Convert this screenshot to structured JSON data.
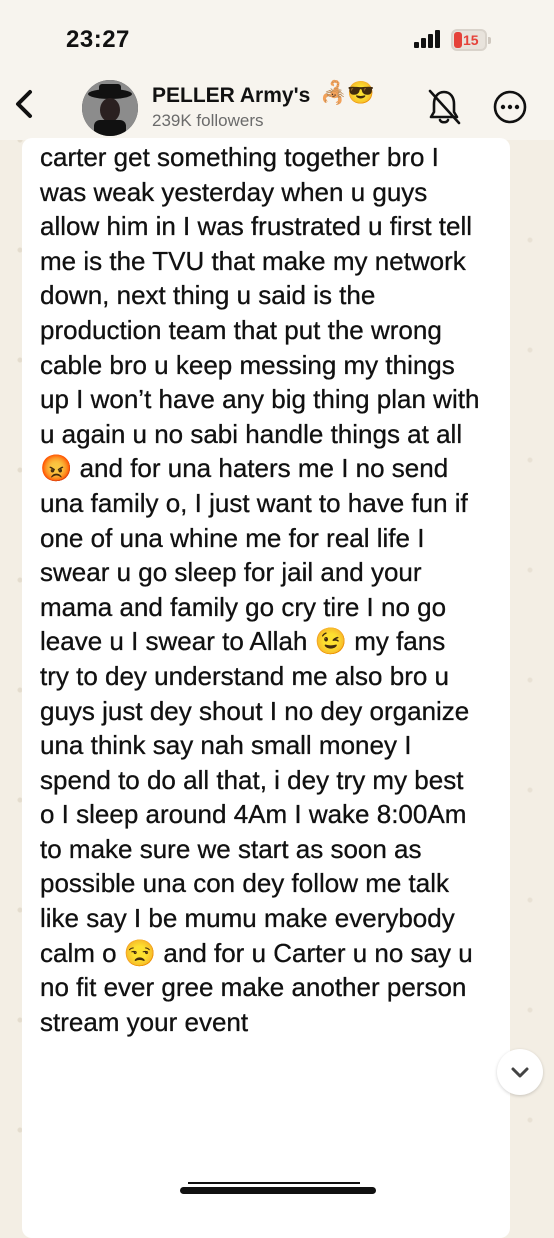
{
  "status_bar": {
    "time": "23:27",
    "battery_level": "15",
    "battery_color": "#e5423a"
  },
  "header": {
    "channel_name": "PELLER Army's",
    "name_emojis": "🦂😎",
    "followers": "239K followers",
    "icons": [
      "back-chevron-icon",
      "avatar",
      "mute-bell-icon",
      "more-options-icon"
    ]
  },
  "message": {
    "text": "carter get something together bro I was weak yesterday when u guys allow him in I was frustrated u first tell me is the TVU that make my network down, next thing u said is the production team that put the wrong cable bro u keep messing my things up I won’t have any big thing plan with u again u no sabi handle things at all😡 and for una haters me I no send una family o, I just want to have fun if one of una whine me for real life I swear u go sleep for jail and your mama and family go cry tire I no go leave u I swear to Allah 😉 my fans try to dey understand me also bro u guys just dey shout I no dey organize una think say nah small money I spend to do all that, i dey try my best o I sleep around 4Am I wake 8:00Am to make sure we start as soon as possible una con dey follow me talk like say I be mumu make everybody calm o 😒 and for u Carter u no say u no fit ever gree make another person stream your event"
  },
  "colors": {
    "background": "#f3eee4",
    "bubble": "#ffffff",
    "text": "#111111",
    "muted_text": "#6b6b6b"
  }
}
